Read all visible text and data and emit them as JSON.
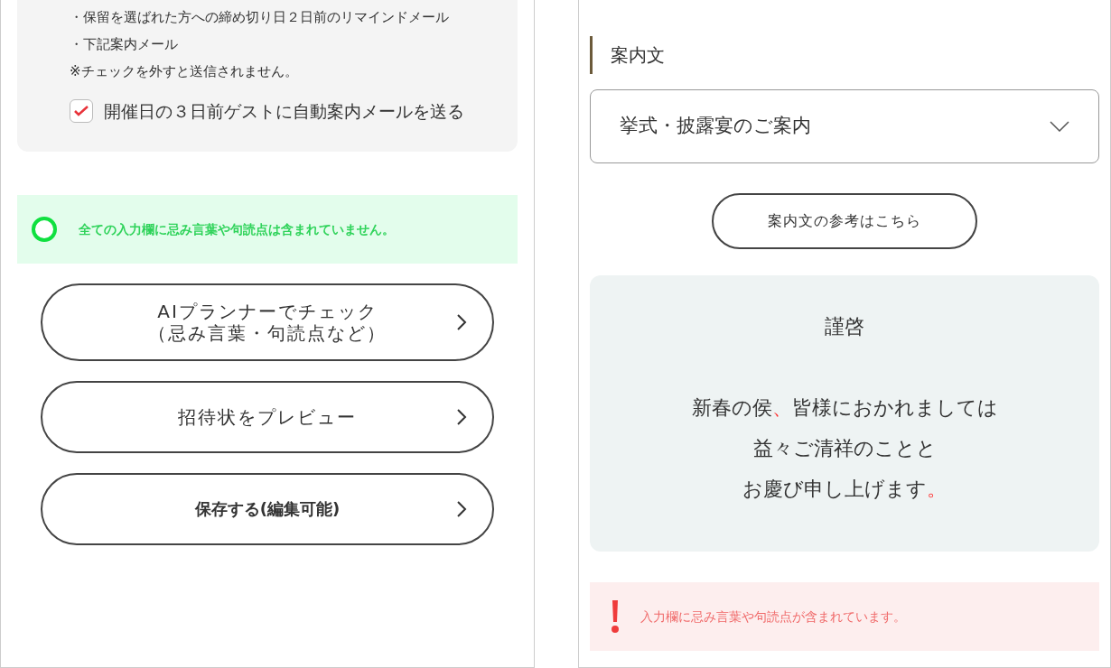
{
  "left_panel": {
    "notes": [
      "・保留を選ばれた方への締め切り日２日前のリマインドメール",
      "・下記案内メール",
      "※チェックを外すと送信されません。"
    ],
    "auto_mail_checkbox": {
      "label": "開催日の３日前ゲストに自動案内メールを送る",
      "checked": true
    },
    "check_result": {
      "kind": "ok",
      "message": "全ての入力欄に忌み言葉や句読点は含まれていません。"
    },
    "buttons": [
      {
        "lines": [
          "AIプランナーでチェック",
          "（忌み言葉・句読点など）"
        ],
        "bold": false
      },
      {
        "lines": [
          "招待状をプレビュー"
        ],
        "bold": false
      },
      {
        "lines": [
          "保存する(編集可能)"
        ],
        "bold": true
      }
    ]
  },
  "right_panel": {
    "section_label": "案内文",
    "template_select": {
      "value": "挙式・披露宴のご案内"
    },
    "reference_button": "案内文の参考はこちら",
    "letter_salutation": "謹啓",
    "letter": [
      [
        {
          "text": "新春の侯",
          "flagged": false
        },
        {
          "text": "、",
          "flagged": true
        },
        {
          "text": "皆様におかれましては",
          "flagged": false
        }
      ],
      [
        {
          "text": "益々ご清祥のことと",
          "flagged": false
        }
      ],
      [
        {
          "text": "お慶び申し上げます",
          "flagged": false
        },
        {
          "text": "。",
          "flagged": true
        }
      ]
    ],
    "check_result": {
      "kind": "error",
      "message": "入力欄に忌み言葉や句読点が含まれています。"
    }
  }
}
